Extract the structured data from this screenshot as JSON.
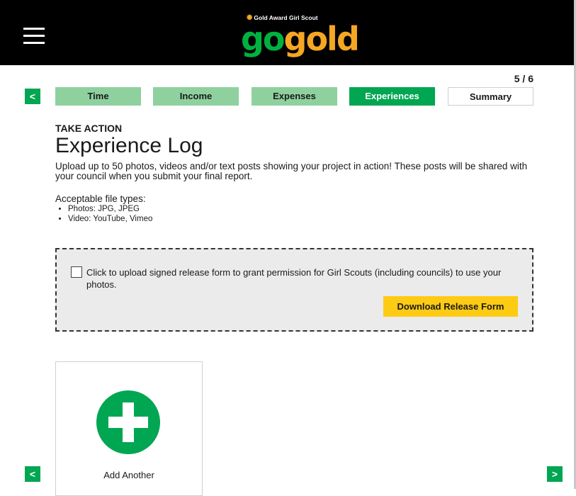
{
  "header": {
    "menu_icon": "hamburger-menu-icon",
    "logo_tagline": "Gold Award Girl Scout",
    "logo_go": "go",
    "logo_gold": "gold"
  },
  "progress": {
    "step_count": "5 / 6",
    "current_step": 5,
    "total_steps": 6
  },
  "nav": {
    "prev_label": "<",
    "next_label": ">"
  },
  "tabs": [
    {
      "label": "Time",
      "state": "done"
    },
    {
      "label": "Income",
      "state": "done"
    },
    {
      "label": "Expenses",
      "state": "done"
    },
    {
      "label": "Experiences",
      "state": "active"
    },
    {
      "label": "Summary",
      "state": "todo"
    }
  ],
  "main": {
    "section_label": "TAKE ACTION",
    "title": "Experience Log",
    "intro": "Upload up to 50 photos, videos and/or text posts showing your project in action! These posts will be shared with your council when you submit your final report.",
    "filetypes_heading": "Acceptable file types:",
    "filetypes": [
      "Photos: JPG, JPEG",
      "Video: YouTube, Vimeo"
    ]
  },
  "release": {
    "checkbox_checked": false,
    "text": "Click to upload signed release form to grant permission for Girl Scouts (including councils) to use your photos.",
    "button_label": "Download Release Form"
  },
  "add_card": {
    "label": "Add Another",
    "icon": "plus-circle-icon"
  },
  "colors": {
    "brand_green": "#00a651",
    "done_tab": "#8fd19e",
    "gold": "#f5a623",
    "download_button": "#fdcb13",
    "header_bg": "#000000"
  }
}
